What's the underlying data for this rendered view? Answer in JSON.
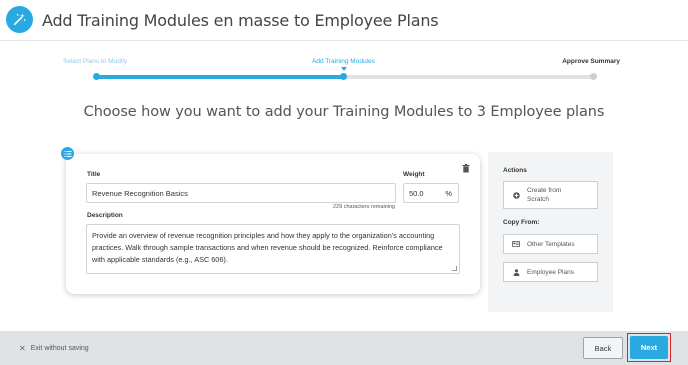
{
  "header": {
    "title": "Add Training Modules en masse to Employee Plans",
    "icon": "magic-wand-icon"
  },
  "steps": [
    {
      "label": "Select Plans to Modify",
      "state": "done"
    },
    {
      "label": "Add Training Modules",
      "state": "current"
    },
    {
      "label": "Approve Summary",
      "state": "upcoming"
    }
  ],
  "main": {
    "heading": "Choose how you want to add your Training Modules to 3 Employee plans"
  },
  "module": {
    "title_label": "Title",
    "title_value": "Revenue Recognition Basics",
    "weight_label": "Weight",
    "weight_value": "50.0",
    "weight_unit": "%",
    "chars_remaining": "229 characters remaining",
    "description_label": "Description",
    "description_value": "Provide an overview of revenue recognition principles and how they apply to the organization’s accounting practices. Walk through sample transactions and when revenue should be recognized. Reinforce compliance with applicable standards (e.g., ASC 606)."
  },
  "actions": {
    "title": "Actions",
    "create_label": "Create from Scratch",
    "copy_from_title": "Copy From:",
    "other_templates_label": "Other Templates",
    "employee_plans_label": "Employee Plans"
  },
  "footer": {
    "exit_label": "Exit without saving",
    "back_label": "Back",
    "next_label": "Next"
  },
  "colors": {
    "accent": "#29a9e0",
    "highlight": "#d9262a",
    "footer_bg": "#dfe3e6"
  }
}
